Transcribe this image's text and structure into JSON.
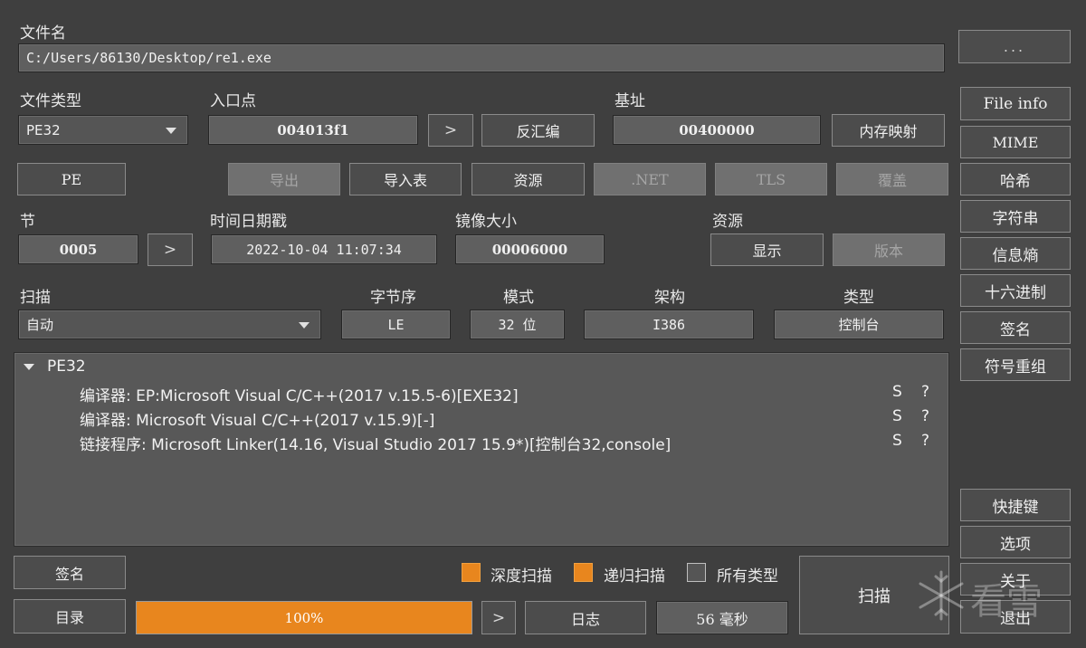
{
  "file": {
    "label": "文件名",
    "path": "C:/Users/86130/Desktop/re1.exe",
    "browse_label": "..."
  },
  "file_type": {
    "label": "文件类型",
    "value": "PE32"
  },
  "entry_point": {
    "label": "入口点",
    "value": "004013f1",
    "arrow": ">",
    "disasm_label": "反汇编"
  },
  "base": {
    "label": "基址",
    "value": "00400000",
    "memmap_label": "内存映射"
  },
  "pe_button": "PE",
  "row_buttons": {
    "export": "导出",
    "import": "导入表",
    "resources": "资源",
    "net": ".NET",
    "tls": "TLS",
    "overlay": "覆盖"
  },
  "sections": {
    "label": "节",
    "value": "0005",
    "arrow": ">"
  },
  "timestamp": {
    "label": "时间日期戳",
    "value": "2022-10-04 11:07:34"
  },
  "image_size": {
    "label": "镜像大小",
    "value": "00006000"
  },
  "resource": {
    "label": "资源",
    "show": "显示",
    "version": "版本"
  },
  "scan": {
    "label": "扫描",
    "mode_value": "自动"
  },
  "endian": {
    "label": "字节序",
    "value": "LE"
  },
  "mode": {
    "label": "模式",
    "value": "32 位"
  },
  "arch": {
    "label": "架构",
    "value": "I386"
  },
  "type": {
    "label": "类型",
    "value": "控制台"
  },
  "results": {
    "root": "PE32",
    "rows": [
      {
        "text": "编译器: EP:Microsoft Visual C/C++(2017 v.15.5-6)[EXE32]",
        "s": "S",
        "q": "?"
      },
      {
        "text": "编译器: Microsoft Visual C/C++(2017 v.15.9)[-]",
        "s": "S",
        "q": "?"
      },
      {
        "text": "链接程序: Microsoft Linker(14.16, Visual Studio 2017 15.9*)[控制台32,console]",
        "s": "S",
        "q": "?"
      }
    ]
  },
  "side": {
    "file_info": "File info",
    "mime": "MIME",
    "hash": "哈希",
    "strings": "字符串",
    "entropy": "信息熵",
    "hex": "十六进制",
    "signature": "签名",
    "demangle": "符号重组",
    "shortcuts": "快捷键",
    "options": "选项",
    "about": "关于",
    "exit": "退出"
  },
  "bottom": {
    "signature": "签名",
    "directory": "目录",
    "deep_scan": "深度扫描",
    "recursive_scan": "递归扫描",
    "all_types": "所有类型",
    "progress_text": "100%",
    "progress": 1.0,
    "arrow": ">",
    "log": "日志",
    "time": "56 毫秒",
    "scan": "扫描"
  },
  "watermark": "看雪",
  "colors": {
    "accent": "#e8861e",
    "background": "#3f3f3f"
  },
  "icons": {
    "tree_toggle": "triangle-down-icon",
    "watermark": "snowflake-icon"
  }
}
